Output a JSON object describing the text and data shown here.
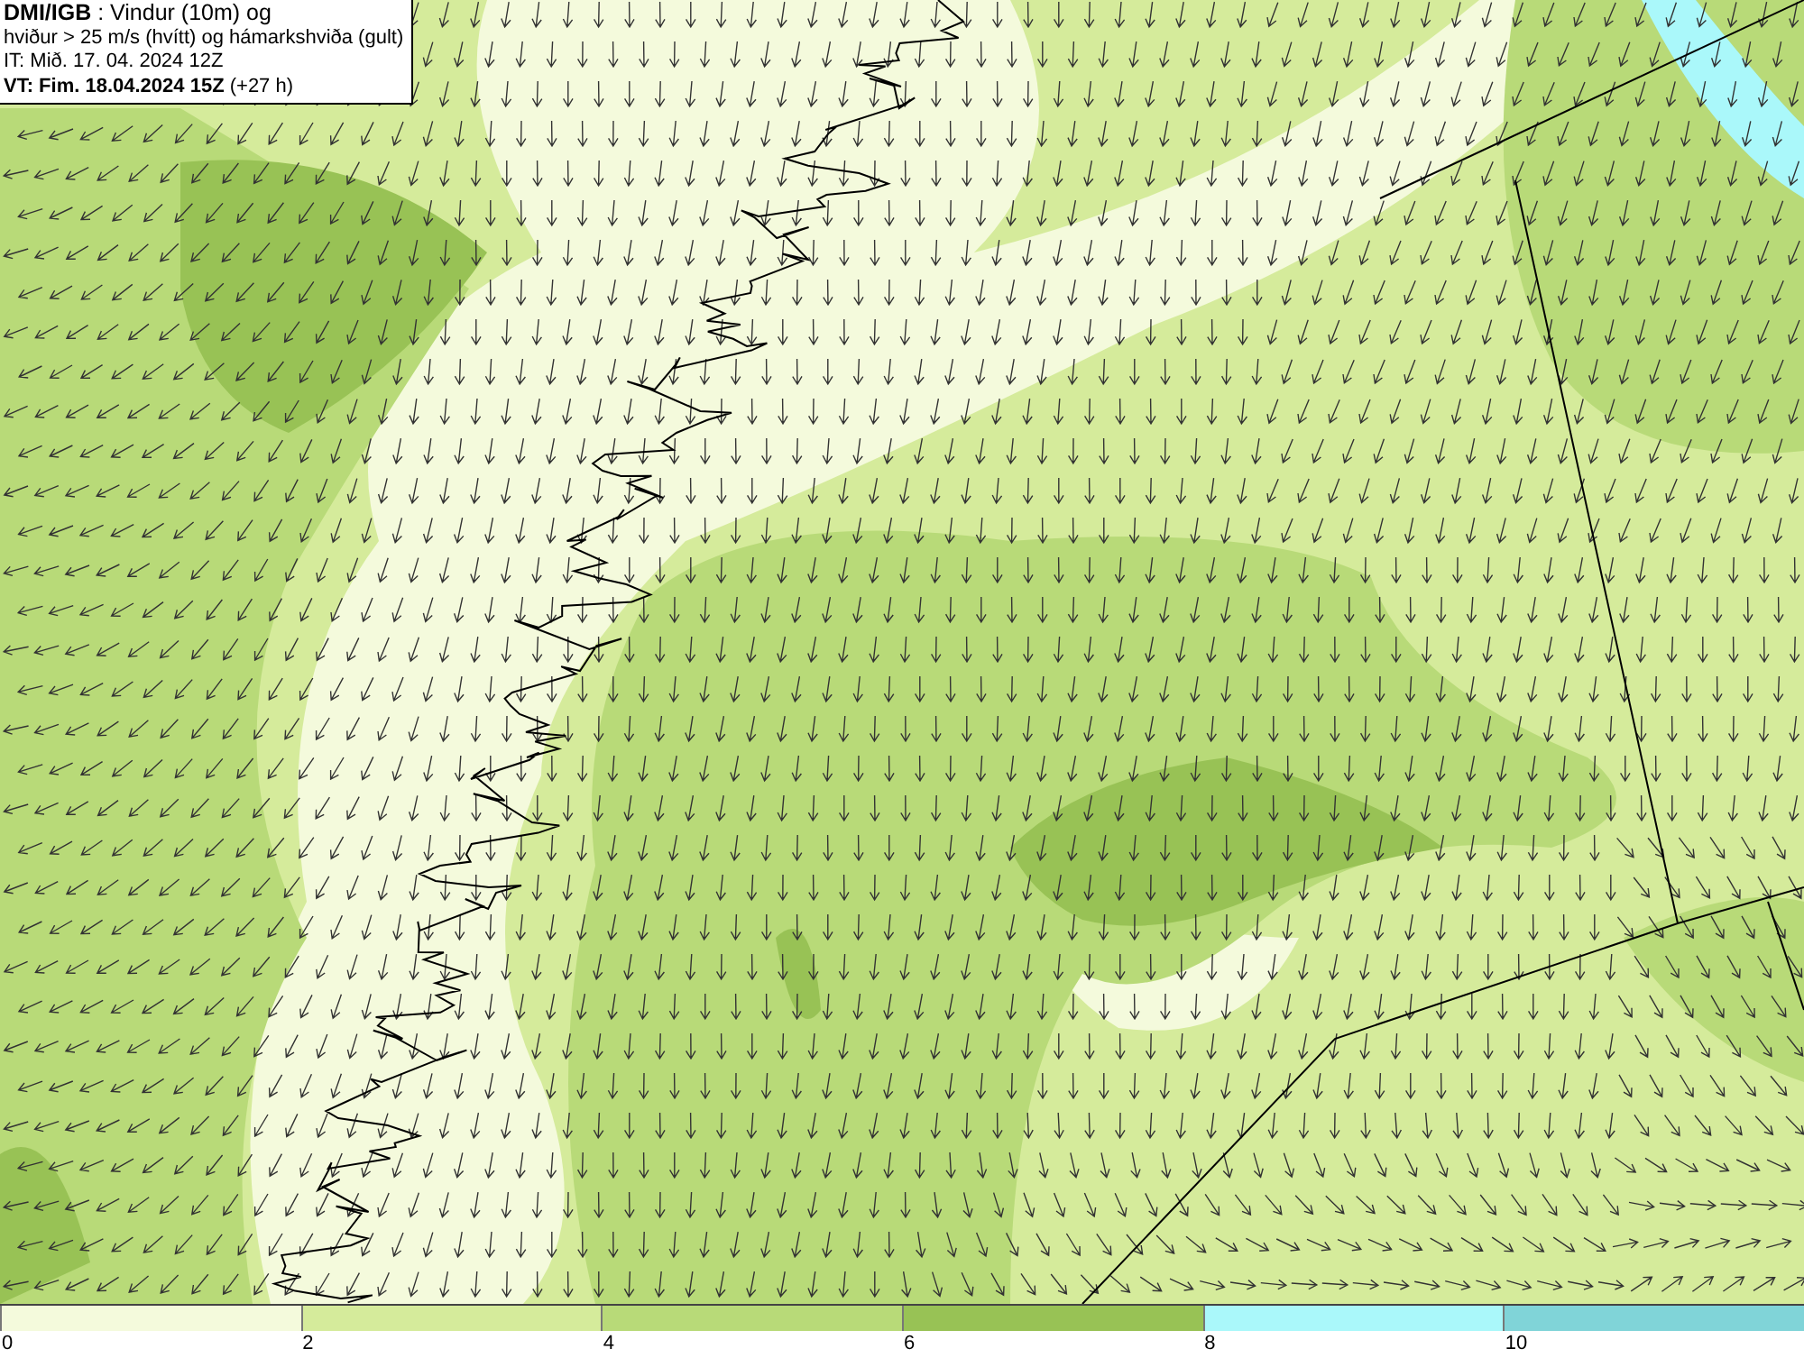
{
  "header": {
    "lines": [
      "**DMI/IGB** : Vindur (10m) og",
      "hviður > 25 m/s (hvítt) og hámarkshviða (gult)",
      "IT: Mið. 17. 04. 2024 12Z",
      "**VT: Fim. 18.04.2024 15Z** (+27 h)"
    ]
  },
  "legend": {
    "bins": [
      {
        "label": "0",
        "color": "#f4fadc"
      },
      {
        "label": "2",
        "color": "#d5eb9b"
      },
      {
        "label": "4",
        "color": "#b8da78"
      },
      {
        "label": "6",
        "color": "#98c255"
      },
      {
        "label": "8",
        "color": "#aaf8fa"
      },
      {
        "label": "10",
        "color": "#80d4d8"
      }
    ]
  }
}
